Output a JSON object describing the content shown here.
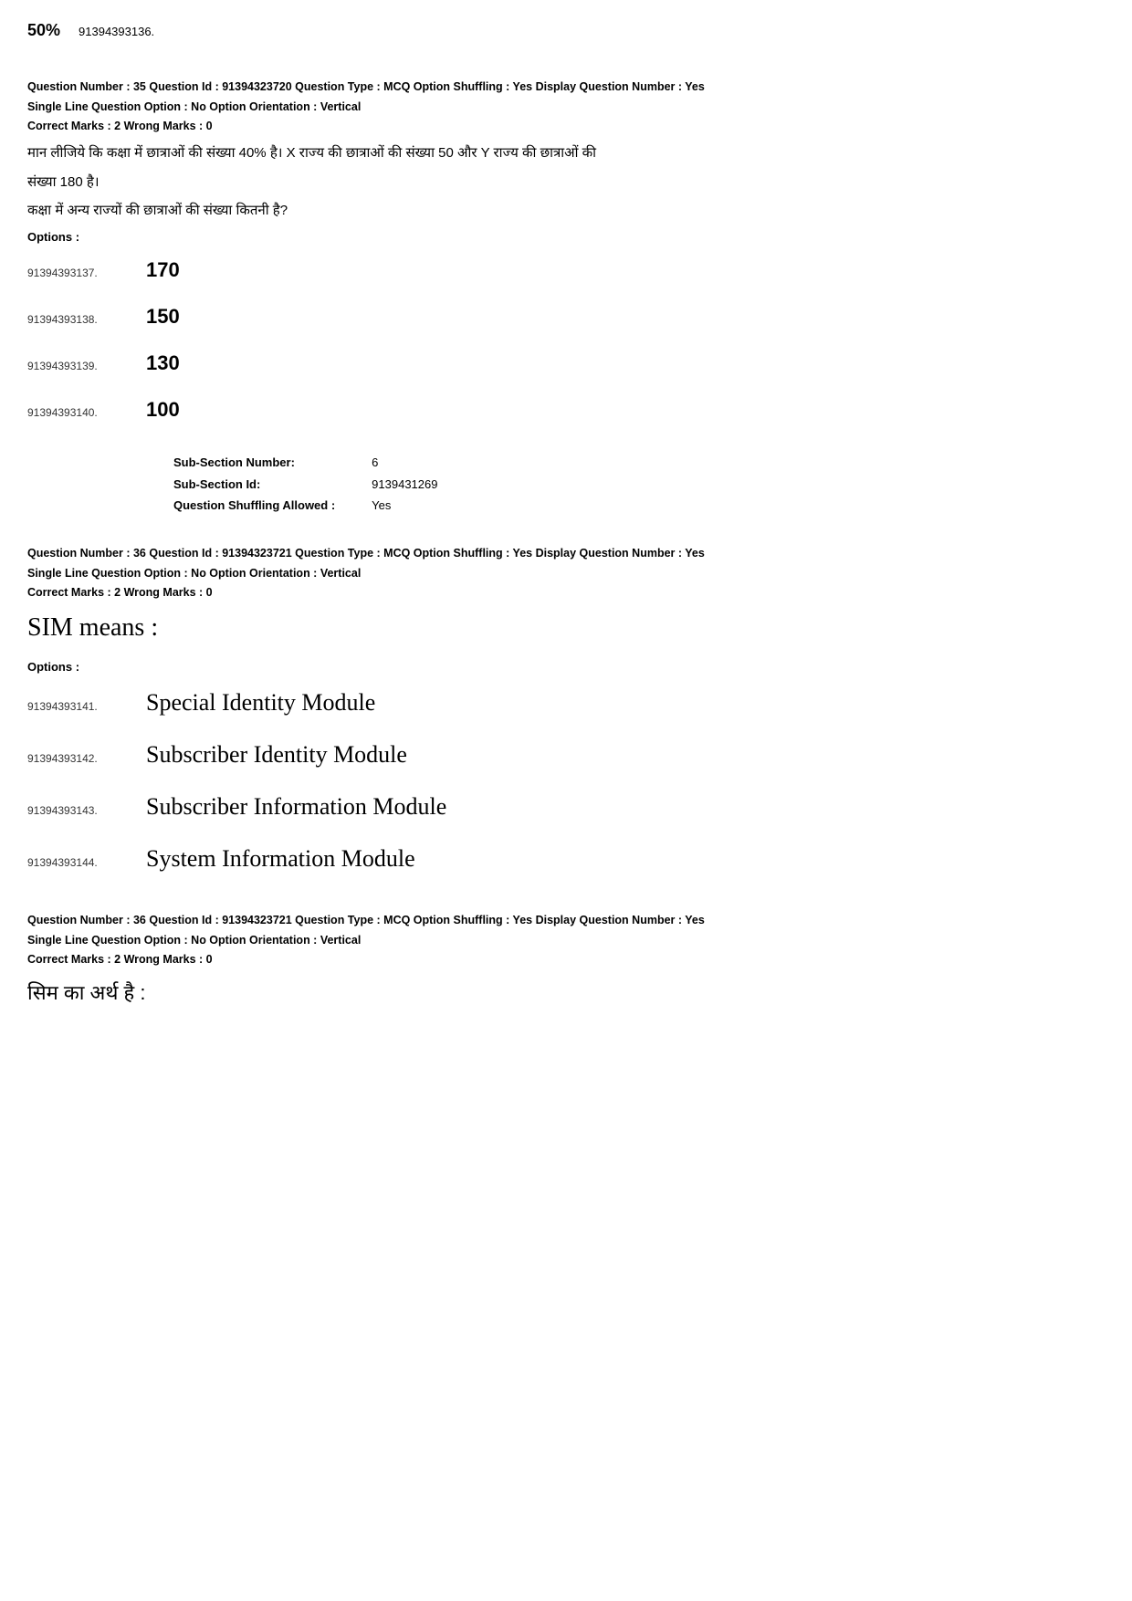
{
  "page": {
    "percent_header": "50%",
    "top_id": "91394393136.",
    "question35": {
      "meta_line1": "Question Number : 35  Question Id : 91394323720  Question Type : MCQ  Option Shuffling : Yes  Display Question Number : Yes",
      "meta_line2": "Single Line Question Option : No  Option Orientation : Vertical",
      "correct_marks": "Correct Marks : 2  Wrong Marks : 0",
      "text_line1": "मान लीजिये कि कक्षा में छात्राओं की संख्या 40% है। X राज्य की छात्राओं की संख्या 50 और Y राज्य की छात्राओं की",
      "text_line2": "संख्या 180 है।",
      "text_line3": "कक्षा में अन्य राज्यों की छात्राओं की संख्या कितनी है?",
      "options_label": "Options :",
      "options": [
        {
          "id": "91394393137.",
          "value": "170"
        },
        {
          "id": "91394393138.",
          "value": "150"
        },
        {
          "id": "91394393139.",
          "value": "130"
        },
        {
          "id": "91394393140.",
          "value": "100"
        }
      ]
    },
    "subsection": {
      "label1": "Sub-Section Number:",
      "value1": "6",
      "label2": "Sub-Section Id:",
      "value2": "9139431269",
      "label3": "Question Shuffling Allowed :",
      "value3": "Yes"
    },
    "question36_en": {
      "meta_line1": "Question Number : 36  Question Id : 91394323721  Question Type : MCQ  Option Shuffling : Yes  Display Question Number : Yes",
      "meta_line2": "Single Line Question Option : No  Option Orientation : Vertical",
      "correct_marks": "Correct Marks : 2  Wrong Marks : 0",
      "text": "SIM means :",
      "options_label": "Options :",
      "options": [
        {
          "id": "91394393141.",
          "value": "Special Identity Module"
        },
        {
          "id": "91394393142.",
          "value": "Subscriber Identity Module"
        },
        {
          "id": "91394393143.",
          "value": "Subscriber Information Module"
        },
        {
          "id": "91394393144.",
          "value": "System Information Module"
        }
      ]
    },
    "question36_hi": {
      "meta_line1": "Question Number : 36  Question Id : 91394323721  Question Type : MCQ  Option Shuffling : Yes  Display Question Number : Yes",
      "meta_line2": "Single Line Question Option : No  Option Orientation : Vertical",
      "correct_marks": "Correct Marks : 2  Wrong Marks : 0",
      "text": "सिम का अर्थ है :"
    }
  }
}
